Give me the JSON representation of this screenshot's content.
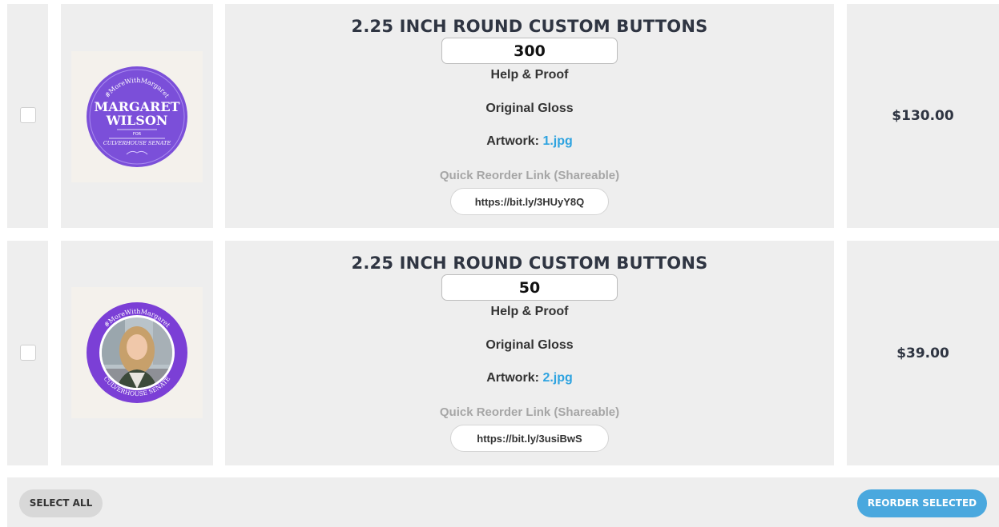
{
  "items": [
    {
      "product": "2.25 INCH ROUND CUSTOM BUTTONS",
      "quantity": "300",
      "help": "Help & Proof",
      "finish": "Original Gloss",
      "artwork_label": "Artwork:",
      "artwork_file": "1.jpg",
      "reorder_label": "Quick Reorder Link (Shareable)",
      "reorder_link": "https://bit.ly/3HUyY8Q",
      "price": "$130.00",
      "button_art": {
        "top_text": "#MoreWithMargaret",
        "name_line1": "MARGARET",
        "name_line2": "WILSON",
        "for_text": "FOR",
        "bottom_text": "CULVERHOUSE SENATE",
        "color": "#7b4fd9"
      }
    },
    {
      "product": "2.25 INCH ROUND CUSTOM BUTTONS",
      "quantity": "50",
      "help": "Help & Proof",
      "finish": "Original Gloss",
      "artwork_label": "Artwork:",
      "artwork_file": "2.jpg",
      "reorder_label": "Quick Reorder Link (Shareable)",
      "reorder_link": "https://bit.ly/3usiBwS",
      "price": "$39.00",
      "button_art": {
        "top_text": "#MoreWithMargaret",
        "bottom_text": "CULVERHOUSE SENATE",
        "color": "#7b3fd6"
      }
    }
  ],
  "footer": {
    "select_all": "SELECT ALL",
    "reorder_selected": "REORDER SELECTED"
  }
}
